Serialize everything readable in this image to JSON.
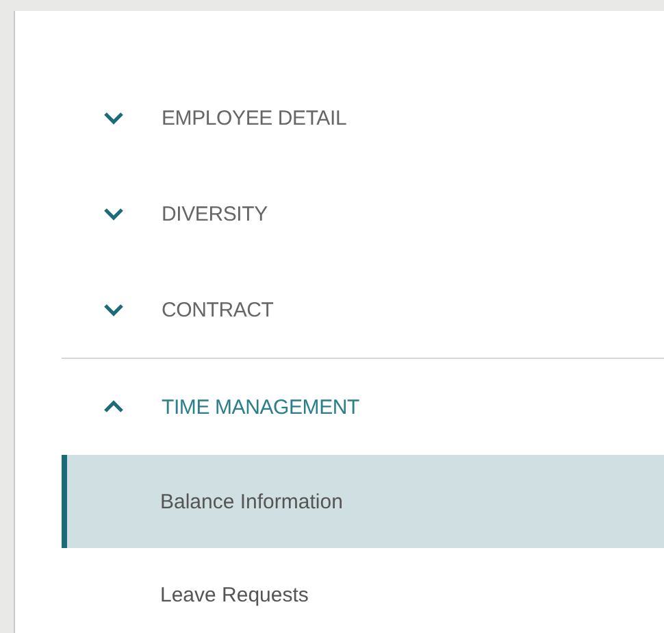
{
  "sections": [
    {
      "label": "EMPLOYEE DETAIL",
      "expanded": false
    },
    {
      "label": "DIVERSITY",
      "expanded": false
    },
    {
      "label": "CONTRACT",
      "expanded": false
    },
    {
      "label": "TIME MANAGEMENT",
      "expanded": true,
      "children": [
        {
          "label": "Balance Information",
          "selected": true
        },
        {
          "label": "Leave Requests",
          "selected": false
        }
      ]
    }
  ]
}
